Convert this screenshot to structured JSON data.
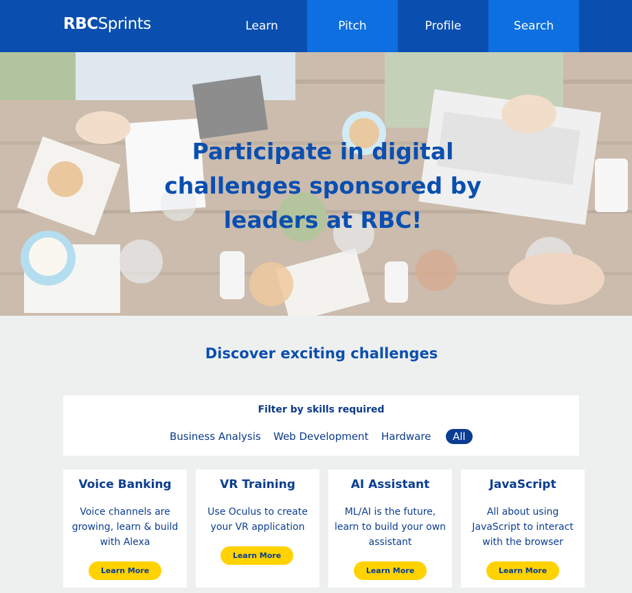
{
  "nav": {
    "logo_bold": "RBC",
    "logo_light": "Sprints",
    "items": [
      {
        "label": "Learn"
      },
      {
        "label": "Pitch"
      },
      {
        "label": "Profile"
      },
      {
        "label": "Search"
      }
    ],
    "colors": {
      "bar": "#0a4fb0",
      "highlight": "#0d6fe0"
    }
  },
  "hero": {
    "title": "Participate in digital challenges sponsored by leaders at RBC!"
  },
  "discover": {
    "title": "Discover exciting challenges"
  },
  "filter": {
    "title": "Filter by skills required",
    "options": [
      "Business Analysis",
      "Web Development",
      "Hardware",
      "All"
    ],
    "selected": "All"
  },
  "cards": [
    {
      "title": "Voice Banking",
      "desc": "Voice channels are growing, learn & build with Alexa",
      "button": "Learn More"
    },
    {
      "title": "VR Training",
      "desc": "Use Oculus to create your VR application",
      "button": "Learn More"
    },
    {
      "title": "AI Assistant",
      "desc": "ML/AI is the future, learn to build your own assistant",
      "button": "Learn More"
    },
    {
      "title": "JavaScript",
      "desc": "All about using JavaScript to interact with the browser",
      "button": "Learn More"
    }
  ],
  "colors": {
    "accent": "#0a4fb0",
    "button": "#ffd200",
    "page_bg": "#eef0ef"
  }
}
